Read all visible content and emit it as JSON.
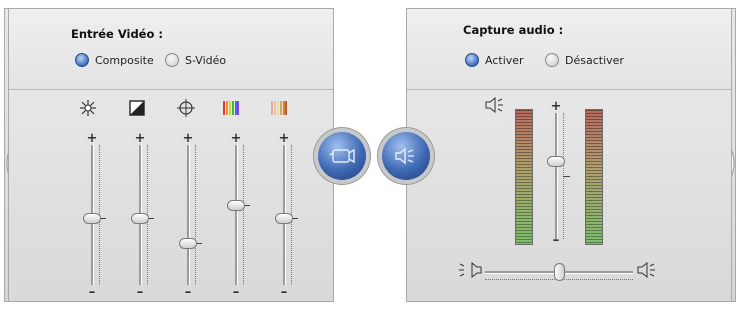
{
  "video": {
    "title": "Entrée Vidéo :",
    "options": [
      {
        "label": "Composite",
        "selected": true
      },
      {
        "label": "S-Vidéo",
        "selected": false
      }
    ],
    "controls": [
      {
        "icon": "brightness-icon",
        "level": 0.48
      },
      {
        "icon": "contrast-icon",
        "level": 0.48
      },
      {
        "icon": "sharpness-icon",
        "level": 0.3
      },
      {
        "icon": "hue-icon",
        "level": 0.57
      },
      {
        "icon": "saturation-icon",
        "level": 0.48
      }
    ],
    "plus": "+",
    "minus": "–"
  },
  "audio": {
    "title": "Capture audio :",
    "options": [
      {
        "label": "Activer",
        "selected": true
      },
      {
        "label": "Désactiver",
        "selected": false
      }
    ],
    "volume_level": 0.62,
    "balance_level": 0.5,
    "plus": "+",
    "minus": "–"
  },
  "buttons": {
    "video_icon": "camera-icon",
    "audio_icon": "speaker-icon"
  }
}
